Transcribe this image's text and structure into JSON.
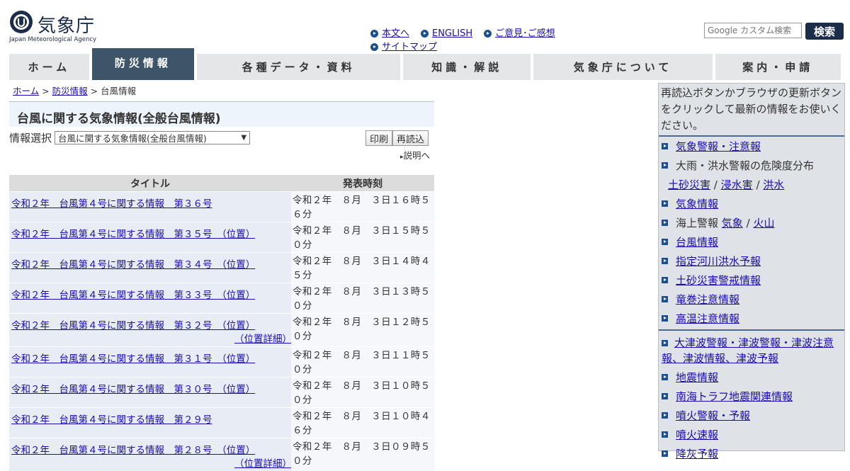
{
  "header": {
    "logo_name": "気象庁",
    "logo_sub": "Japan Meteorological Agency",
    "links_row1": [
      "本文へ",
      "ENGLISH",
      "ご意見･ご感想"
    ],
    "links_row2": [
      "サイトマップ"
    ],
    "search_placeholder": "Google カスタム検索",
    "search_button": "検索"
  },
  "nav": [
    "ホーム",
    "防災情報",
    "各種データ・資料",
    "知識・解説",
    "気象庁について",
    "案内・申請"
  ],
  "breadcrumb": {
    "home": "ホーム",
    "bosai": "防災情報",
    "current": "台風情報",
    "sep": ">"
  },
  "page": {
    "title": "台風に関する気象情報(全般台風情報)",
    "selector_label": "情報選択",
    "selector_value": "台風に関する気象情報(全般台風情報)",
    "print_button": "印刷",
    "reload_button": "再読込",
    "explain_link": "説明へ"
  },
  "table": {
    "headers": [
      "タイトル",
      "発表時刻"
    ],
    "rows": [
      {
        "title": "令和２年　台風第４号に関する情報　第３６号",
        "extra": "",
        "time": "令和２年　８月　３日１６時５６分"
      },
      {
        "title": "令和２年　台風第４号に関する情報　第３５号　（位置）",
        "extra": "",
        "time": "令和２年　８月　３日１５時５０分"
      },
      {
        "title": "令和２年　台風第４号に関する情報　第３４号　（位置）",
        "extra": "",
        "time": "令和２年　８月　３日１４時４５分"
      },
      {
        "title": "令和２年　台風第４号に関する情報　第３３号　（位置）",
        "extra": "",
        "time": "令和２年　８月　３日１３時５０分"
      },
      {
        "title": "令和２年　台風第４号に関する情報　第３２号　（位置）",
        "extra": "（位置詳細）",
        "time": "令和２年　８月　３日１２時５０分"
      },
      {
        "title": "令和２年　台風第４号に関する情報　第３１号　（位置）",
        "extra": "",
        "time": "令和２年　８月　３日１１時５０分"
      },
      {
        "title": "令和２年　台風第４号に関する情報　第３０号　（位置）",
        "extra": "",
        "time": "令和２年　８月　３日１０時５０分"
      },
      {
        "title": "令和２年　台風第４号に関する情報　第２９号",
        "extra": "",
        "time": "令和２年　８月　３日１０時４６分"
      },
      {
        "title": "令和２年　台風第４号に関する情報　第２８号　（位置）",
        "extra": "（位置詳細）",
        "time": "令和２年　８月　３日０９時５０分"
      }
    ]
  },
  "sidebar": {
    "note": "再読込ボタンかブラウザの更新ボタンをクリックして最新の情報をお使いください。",
    "items": {
      "keiho": "気象警報・注意報",
      "kiken_label": "大雨・洪水警報の危険度分布",
      "dosha": "土砂災害",
      "shinsui": "浸水害",
      "kozui": "洪水",
      "slash": "/",
      "kisho_joho": "気象情報",
      "kaijo_label": "海上警報",
      "kaijo_kisho": "気象",
      "kaijo_kazan": "火山",
      "taifu": "台風情報",
      "kasen": "指定河川洪水予報",
      "doshakeikai": "土砂災害警戒情報",
      "tatsumaki": "竜巻注意情報",
      "koon": "高温注意情報",
      "tsunami": "大津波警報・津波警報・津波注意報、津波情報、津波予報",
      "jishin": "地震情報",
      "nankai": "南海トラフ地震関連情報",
      "funka": "噴火警報・予報",
      "funka_sokuho": "噴火速報",
      "kouhai": "降灰予報"
    }
  },
  "colors": {
    "nav_active": "#3e5468",
    "link": "#1a0dab",
    "brand": "#1c2d4a"
  }
}
